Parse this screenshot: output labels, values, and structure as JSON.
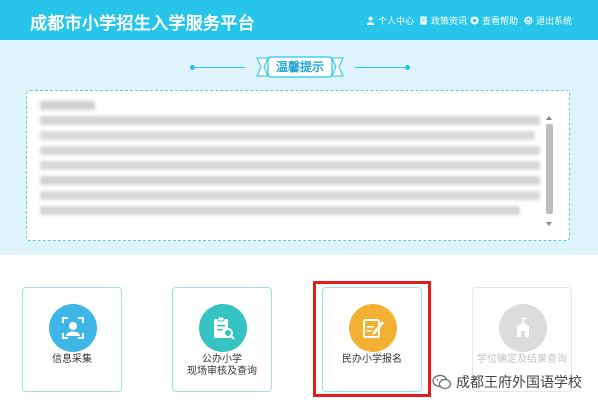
{
  "header": {
    "title": "成都市小学招生入学服务平台",
    "nav": [
      {
        "label": "个人中心",
        "icon": "user-icon"
      },
      {
        "label": "政策资讯",
        "icon": "document-icon"
      },
      {
        "label": "查看帮助",
        "icon": "help-icon"
      },
      {
        "label": "退出系统",
        "icon": "power-icon"
      }
    ]
  },
  "notice": {
    "title": "温馨提示"
  },
  "cards": [
    {
      "label": "信息采集",
      "icon": "face-scan-icon",
      "color": "#3fb7e6"
    },
    {
      "label": "公办小学\n现场审核及查询",
      "icon": "clipboard-search-icon",
      "color": "#36c4c2"
    },
    {
      "label": "民办小学报名",
      "icon": "edit-icon",
      "color": "#f2b133"
    },
    {
      "label": "学位确定及结果查询",
      "icon": "school-icon",
      "color": "#dcdcdc"
    }
  ],
  "watermark": {
    "text": "成都王府外国语学校"
  },
  "colors": {
    "header": "#27c5ea",
    "panel": "#dff4fa",
    "highlight": "#e41c1c"
  }
}
